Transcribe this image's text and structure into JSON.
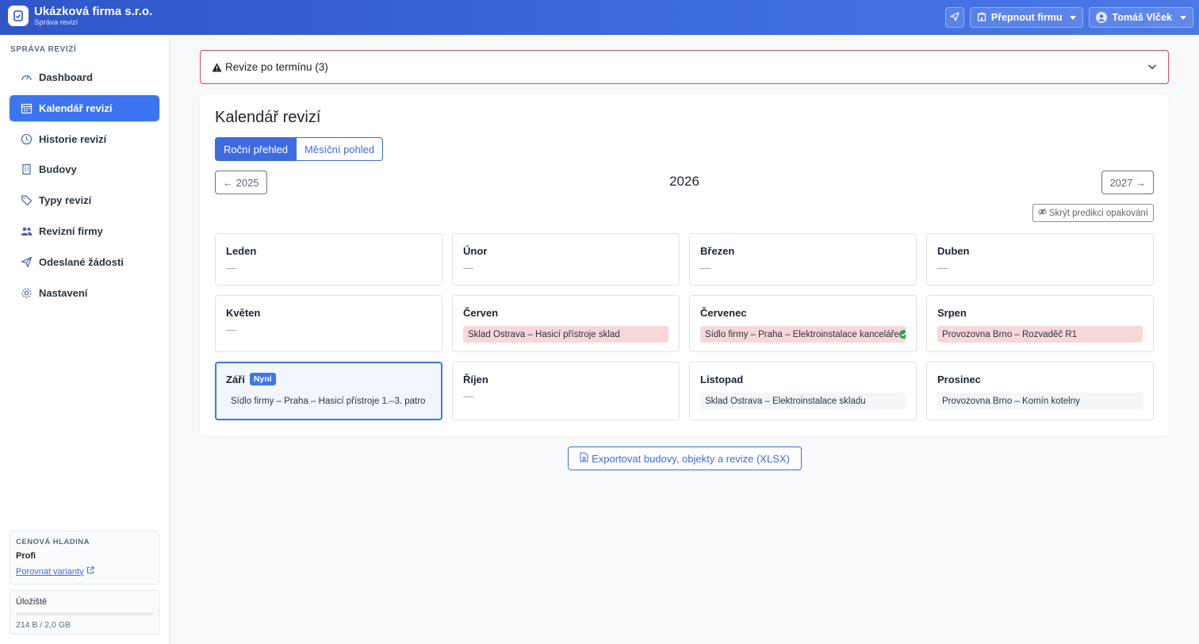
{
  "app": {
    "company_name": "Ukázková firma s.r.o.",
    "subtitle": "Správa revizí"
  },
  "topbar": {
    "switch_company_label": "Přepnout firmu",
    "user_name": "Tomáš Vlček"
  },
  "sidebar": {
    "heading": "SPRÁVA REVIZÍ",
    "items": [
      {
        "label": "Dashboard",
        "icon": "gauge-icon",
        "active": false
      },
      {
        "label": "Kalendář revizí",
        "icon": "calendar-icon",
        "active": true
      },
      {
        "label": "Historie revizí",
        "icon": "clock-icon",
        "active": false
      },
      {
        "label": "Budovy",
        "icon": "building-icon",
        "active": false
      },
      {
        "label": "Typy revizí",
        "icon": "tags-icon",
        "active": false
      },
      {
        "label": "Revizní firmy",
        "icon": "people-icon",
        "active": false
      },
      {
        "label": "Odeslané žádosti",
        "icon": "send-icon",
        "active": false
      },
      {
        "label": "Nastavení",
        "icon": "gear-icon",
        "active": false
      }
    ],
    "plan": {
      "heading": "CENOVÁ HLADINA",
      "name": "Profi",
      "compare_link": "Porovnat varianty"
    },
    "storage": {
      "label": "Úložiště",
      "value": "214 B / 2,0 GB",
      "fraction_used": 0.0
    }
  },
  "alert": {
    "label": "Revize po termínu (3)"
  },
  "calendar": {
    "title": "Kalendář revizí",
    "view_tabs": [
      "Roční přehled",
      "Měsíční pohled"
    ],
    "prev_year_label": "← 2025",
    "year": "2026",
    "next_year_label": "2027 →",
    "hide_prediction_label": "Skrýt predikci opakování",
    "empty_marker": "—",
    "now_badge": "Nyní",
    "months": [
      {
        "name": "Leden",
        "items": []
      },
      {
        "name": "Únor",
        "items": []
      },
      {
        "name": "Březen",
        "items": []
      },
      {
        "name": "Duben",
        "items": []
      },
      {
        "name": "Květen",
        "items": []
      },
      {
        "name": "Červen",
        "items": [
          {
            "text": "Sklad Ostrava – Hasicí přístroje sklad",
            "status": "overdue"
          }
        ]
      },
      {
        "name": "Červenec",
        "items": [
          {
            "text": "Sídlo firmy – Praha – Elektroinstalace kanceláře",
            "status": "overdue-done"
          }
        ]
      },
      {
        "name": "Srpen",
        "items": [
          {
            "text": "Provozovna Brno – Rozvaděč R1",
            "status": "overdue"
          }
        ]
      },
      {
        "name": "Září",
        "current": true,
        "items": [
          {
            "text": "Sídlo firmy – Praha – Hasicí přístroje 1.–3. patro",
            "status": "planned"
          }
        ]
      },
      {
        "name": "Říjen",
        "items": []
      },
      {
        "name": "Listopad",
        "items": [
          {
            "text": "Sklad Ostrava – Elektroinstalace skladu",
            "status": "planned"
          }
        ]
      },
      {
        "name": "Prosinec",
        "items": [
          {
            "text": "Provozovna Brno – Komín kotelny",
            "status": "planned"
          }
        ]
      }
    ]
  },
  "export": {
    "label": "Exportovat budovy, objekty a revize (XLSX)"
  },
  "colors": {
    "primary": "#3d6be0",
    "active_nav": "#3d75f0",
    "overdue_bg": "#f8d7da",
    "alert_border": "#d9465a",
    "done_green": "#2f9e55"
  }
}
